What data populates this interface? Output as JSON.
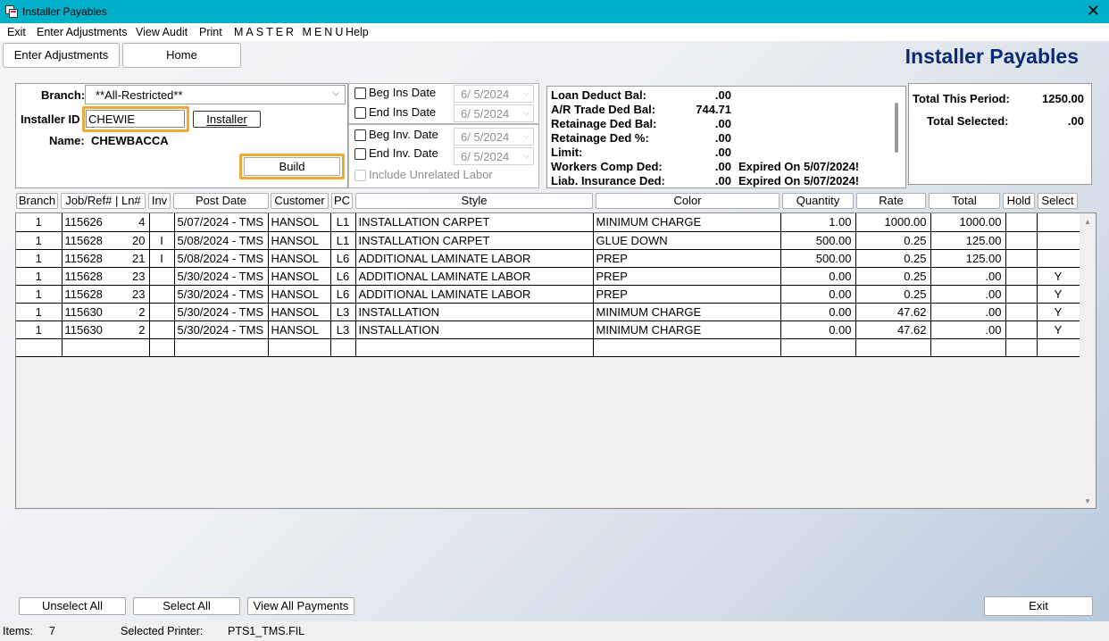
{
  "window": {
    "title": "Installer Payables",
    "close_glyph": "✕"
  },
  "menu": [
    "Exit",
    "Enter Adjustments",
    "View Audit",
    "Print",
    "MASTER MENU",
    "Help"
  ],
  "tabs": {
    "enter_adjustments": "Enter Adjustments",
    "home": "Home"
  },
  "page_title": "Installer Payables",
  "filters": {
    "branch_label": "Branch:",
    "branch_value": "**All-Restricted**",
    "installer_id_label": "Installer ID",
    "installer_id_value": "CHEWIE",
    "installer_button": "Installer",
    "name_label": "Name:",
    "name_value": "CHEWBACCA",
    "build_button": "Build"
  },
  "dates": {
    "beg_ins_label": "Beg Ins Date",
    "beg_ins_value": "6/  5/2024",
    "end_ins_label": "End Ins Date",
    "end_ins_value": "6/  5/2024",
    "beg_inv_label": "Beg Inv. Date",
    "beg_inv_value": "6/  5/2024",
    "end_inv_label": "End Inv. Date",
    "end_inv_value": "6/  5/2024",
    "include_unrelated_label": "Include Unrelated Labor"
  },
  "balances": {
    "loan_label": "Loan Deduct Bal:",
    "loan_value": ".00",
    "ar_label": "A/R Trade Ded Bal:",
    "ar_value": "744.71",
    "retainage_bal_label": "Retainage Ded Bal:",
    "retainage_bal_value": ".00",
    "retainage_pct_label": "Retainage Ded %:",
    "retainage_pct_value": ".00",
    "limit_label": "Limit:",
    "limit_value": ".00",
    "workers_label": "Workers Comp Ded:",
    "workers_value": ".00",
    "workers_expired": "Expired On  5/07/2024!",
    "liab_label": "Liab. Insurance Ded:",
    "liab_value": ".00",
    "liab_expired": "Expired On  5/07/2024!"
  },
  "totals": {
    "period_label": "Total This Period:",
    "period_value": "1250.00",
    "selected_label": "Total Selected:",
    "selected_value": ".00"
  },
  "columns": [
    "Branch",
    "Job/Ref# | Ln#",
    "Inv",
    "Post Date",
    "Customer",
    "PC",
    "Style",
    "Color",
    "Quantity",
    "Rate",
    "Total",
    "Hold",
    "Select"
  ],
  "rows": [
    {
      "branch": "1",
      "job": "115626",
      "ln": "4",
      "inv": "",
      "post": "5/07/2024 - TMS",
      "customer": "HANSOL",
      "pc": "L1",
      "style": "INSTALLATION CARPET",
      "color": "MINIMUM CHARGE",
      "qty": "1.00",
      "rate": "1000.00",
      "total": "1000.00",
      "hold": "",
      "select": ""
    },
    {
      "branch": "1",
      "job": "115628",
      "ln": "20",
      "inv": "I",
      "post": "5/08/2024 - TMS",
      "customer": "HANSOL",
      "pc": "L1",
      "style": "INSTALLATION CARPET",
      "color": "GLUE DOWN",
      "qty": "500.00",
      "rate": "0.25",
      "total": "125.00",
      "hold": "",
      "select": ""
    },
    {
      "branch": "1",
      "job": "115628",
      "ln": "21",
      "inv": "I",
      "post": "5/08/2024 - TMS",
      "customer": "HANSOL",
      "pc": "L6",
      "style": "ADDITIONAL LAMINATE LABOR",
      "color": "PREP",
      "qty": "500.00",
      "rate": "0.25",
      "total": "125.00",
      "hold": "",
      "select": ""
    },
    {
      "branch": "1",
      "job": "115628",
      "ln": "23",
      "inv": "",
      "post": "5/30/2024 - TMS",
      "customer": "HANSOL",
      "pc": "L6",
      "style": "ADDITIONAL LAMINATE LABOR",
      "color": "PREP",
      "qty": "0.00",
      "rate": "0.25",
      "total": ".00",
      "hold": "",
      "select": "Y"
    },
    {
      "branch": "1",
      "job": "115628",
      "ln": "23",
      "inv": "",
      "post": "5/30/2024 - TMS",
      "customer": "HANSOL",
      "pc": "L6",
      "style": "ADDITIONAL LAMINATE LABOR",
      "color": "PREP",
      "qty": "0.00",
      "rate": "0.25",
      "total": ".00",
      "hold": "",
      "select": "Y"
    },
    {
      "branch": "1",
      "job": "115630",
      "ln": "2",
      "inv": "",
      "post": "5/30/2024 - TMS",
      "customer": "HANSOL",
      "pc": "L3",
      "style": "INSTALLATION",
      "color": "MINIMUM CHARGE",
      "qty": "0.00",
      "rate": "47.62",
      "total": ".00",
      "hold": "",
      "select": "Y"
    },
    {
      "branch": "1",
      "job": "115630",
      "ln": "2",
      "inv": "",
      "post": "5/30/2024 - TMS",
      "customer": "HANSOL",
      "pc": "L3",
      "style": "INSTALLATION",
      "color": "MINIMUM CHARGE",
      "qty": "0.00",
      "rate": "47.62",
      "total": ".00",
      "hold": "",
      "select": "Y"
    },
    {
      "branch": "",
      "job": "",
      "ln": "",
      "inv": "",
      "post": "",
      "customer": "",
      "pc": "",
      "style": "",
      "color": "",
      "qty": "",
      "rate": "",
      "total": "",
      "hold": "",
      "select": ""
    }
  ],
  "bottom_buttons": {
    "unselect_all": "Unselect All",
    "select_all": "Select All",
    "view_all_payments": "View All Payments",
    "exit": "Exit"
  },
  "status": {
    "items_label": "Items:",
    "items_value": "7",
    "printer_label": "Selected Printer:",
    "printer_value": "PTS1_TMS.FIL"
  },
  "colors": {
    "title_bar": "#00b0c8",
    "heading": "#0a2a78",
    "highlight": "#f2a833"
  }
}
